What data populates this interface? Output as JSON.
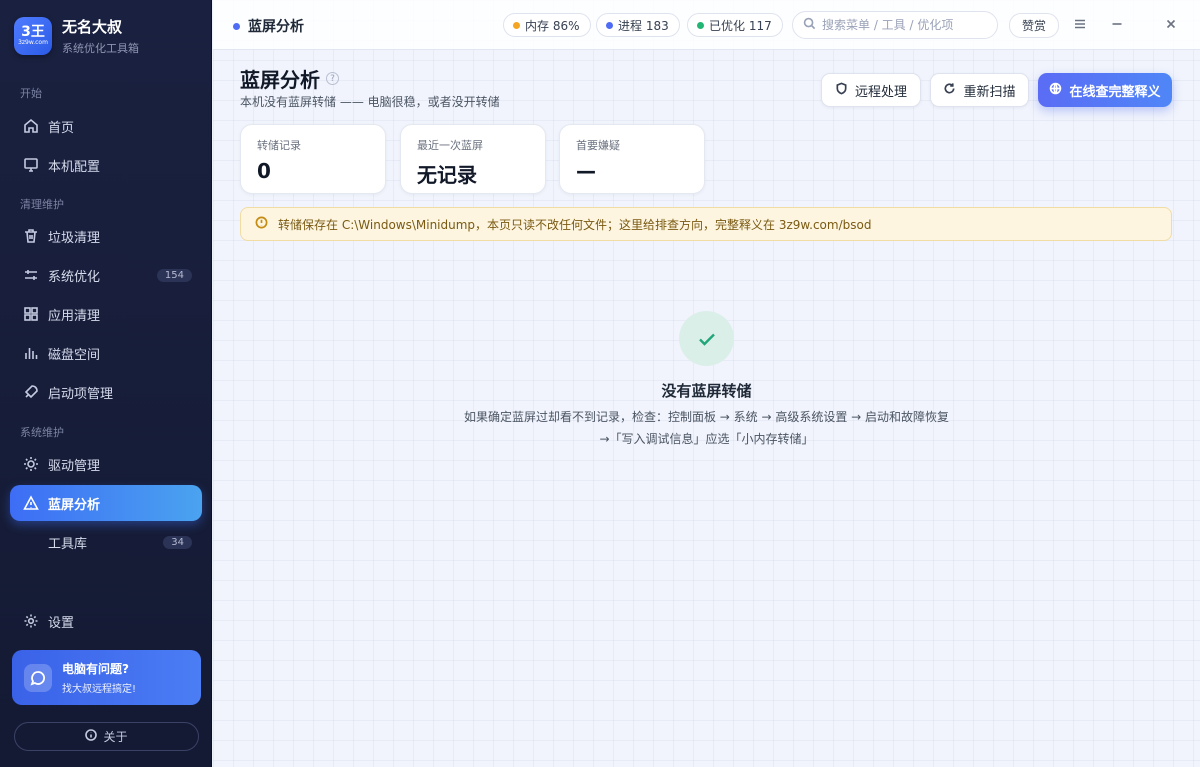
{
  "app": {
    "logo_main": "3王",
    "logo_sub": "3z9w.com",
    "name": "无名大叔",
    "subtitle": "系统优化工具箱"
  },
  "sidebar": {
    "sections": {
      "start": "开始",
      "clean": "清理维护",
      "system": "系统维护"
    },
    "items": [
      {
        "label": "首页",
        "icon": "home-icon"
      },
      {
        "label": "本机配置",
        "icon": "monitor-icon"
      },
      {
        "label": "垃圾清理",
        "icon": "trash-icon"
      },
      {
        "label": "系统优化",
        "icon": "sliders-icon",
        "badge": "154"
      },
      {
        "label": "应用清理",
        "icon": "grid-icon"
      },
      {
        "label": "磁盘空间",
        "icon": "bar-chart-icon"
      },
      {
        "label": "启动项管理",
        "icon": "rocket-icon"
      },
      {
        "label": "驱动管理",
        "icon": "sun-icon"
      },
      {
        "label": "蓝屏分析",
        "icon": "warning-icon",
        "active": true
      },
      {
        "label": "工具库",
        "badge": "34"
      }
    ],
    "settings": "设置",
    "help": {
      "title": "电脑有问题?",
      "text": "找大叔远程搞定!"
    },
    "about": "关于"
  },
  "topbar": {
    "title": "蓝屏分析",
    "memory": "内存 86%",
    "process": "进程 183",
    "optimized": "已优化 117",
    "search_placeholder": "搜索菜单 / 工具 / 优化项",
    "praise": "赞赏",
    "colors": {
      "memory": "#f5a524",
      "process": "#4f6cf5",
      "optimized": "#22b573"
    }
  },
  "page": {
    "title": "蓝屏分析",
    "help_mark": "?",
    "subtitle": "本机没有蓝屏转储 —— 电脑很稳，或者没开转储",
    "buttons": {
      "remote": "远程处理",
      "rescan": "重新扫描",
      "online": "在线查完整释义"
    },
    "stats": [
      {
        "label": "转储记录",
        "value": "0"
      },
      {
        "label": "最近一次蓝屏",
        "value": "无记录"
      },
      {
        "label": "首要嫌疑",
        "value": "—"
      }
    ],
    "notice": "转储保存在 C:\\Windows\\Minidump，本页只读不改任何文件；这里给排查方向，完整释义在 3z9w.com/bsod",
    "empty": {
      "title": "没有蓝屏转储",
      "line1": "如果确定蓝屏过却看不到记录，检查：控制面板 → 系统 → 高级系统设置 → 启动和故障恢复",
      "line2": "→「写入调试信息」应选「小内存转储」"
    }
  }
}
